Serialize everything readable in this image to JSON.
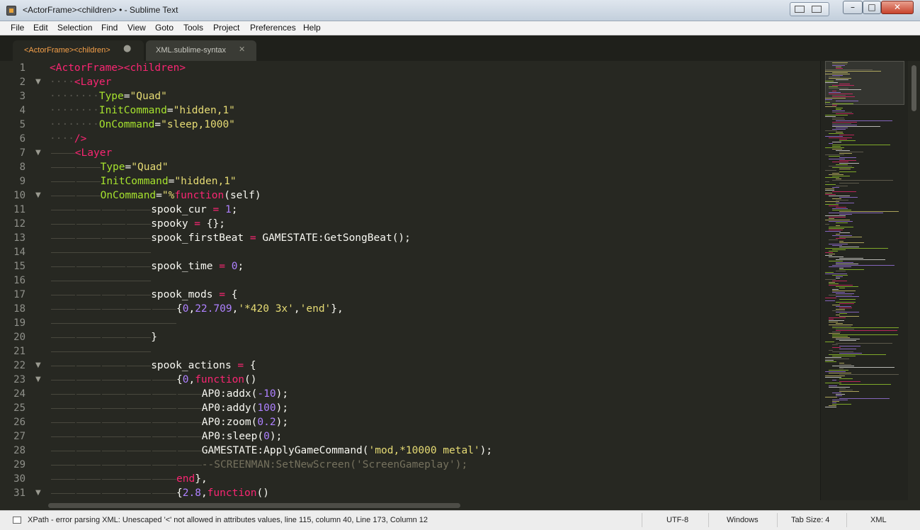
{
  "window": {
    "title": "<ActorFrame><children> • - Sublime Text"
  },
  "menu": [
    "File",
    "Edit",
    "Selection",
    "Find",
    "View",
    "Goto",
    "Tools",
    "Project",
    "Preferences",
    "Help"
  ],
  "tabs": [
    {
      "label": "<ActorFrame><children>",
      "control": "●",
      "active": true
    },
    {
      "label": "XML.sublime-syntax",
      "control": "✕",
      "active": false
    }
  ],
  "editor": {
    "line_numbers": [
      "1",
      "2",
      "3",
      "4",
      "5",
      "6",
      "7",
      "8",
      "9",
      "10",
      "11",
      "12",
      "13",
      "14",
      "15",
      "16",
      "17",
      "18",
      "19",
      "20",
      "21",
      "22",
      "23",
      "24",
      "25",
      "26",
      "27",
      "28",
      "29",
      "30",
      "31"
    ],
    "folded_lines": [
      2,
      7,
      10,
      22,
      23,
      31
    ],
    "lines": [
      "<ActorFrame><children>",
      "····<Layer",
      "········Type=\"Quad\"",
      "········InitCommand=\"hidden,1\"",
      "········OnCommand=\"sleep,1000\"",
      "····/>",
      "<Layer",
      "Type=\"Quad\"",
      "InitCommand=\"hidden,1\"",
      "OnCommand=\"%function(self)",
      "spook_cur = 1;",
      "spooky = {};",
      "spook_firstBeat = GAMESTATE:GetSongBeat();",
      "",
      "spook_time = 0;",
      "",
      "spook_mods = {",
      "{0,22.709,'*420 3x','end'},",
      "",
      "}",
      "",
      "spook_actions = {",
      "{0,function()",
      "AP0:addx(-10);",
      "AP0:addy(100);",
      "AP0:zoom(0.2);",
      "AP0:sleep(0);",
      "GAMESTATE:ApplyGameCommand('mod,*10000 metal');",
      "--SCREENMAN:SetNewScreen('ScreenGameplay');",
      "end},",
      "{2.8,function()"
    ]
  },
  "status": {
    "message": "XPath - error parsing XML: Unescaped '<' not allowed in attributes values, line 115, column 40, Line 173, Column 12",
    "encoding": "UTF-8",
    "line_endings": "Windows",
    "tab_size": "Tab Size: 4",
    "syntax": "XML"
  },
  "colors": {
    "background": "#272822",
    "tag": "#f92672",
    "attribute": "#a6e22e",
    "string": "#e6db74",
    "number": "#ae81ff",
    "comment": "#75715e",
    "active_tab_text": "#f5a04a"
  },
  "icons": [
    "app-icon",
    "tab-dirty-icon",
    "tab-close-icon",
    "fold-arrow-icon",
    "minimize-icon",
    "maximize-icon",
    "close-icon",
    "status-panel-icon"
  ]
}
